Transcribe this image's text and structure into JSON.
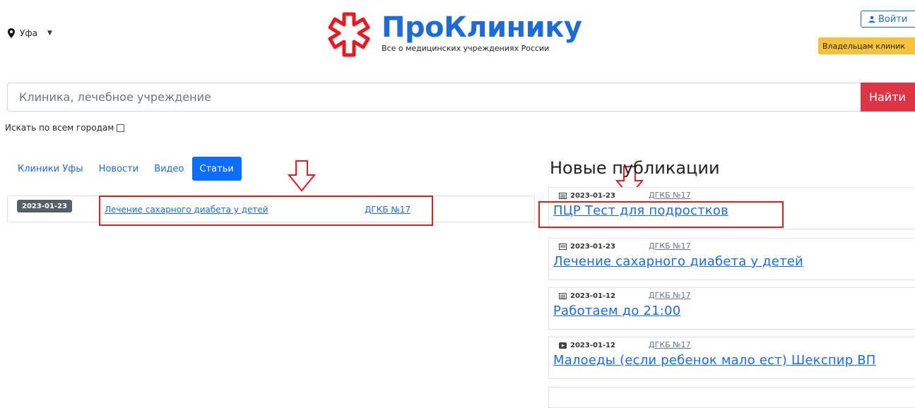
{
  "header": {
    "city": "Уфа",
    "logo_title": "ПроКлинику",
    "logo_subtitle": "Все о медицинских учреждениях России",
    "login_label": "Войти",
    "owners_label": "Владельцам клиник"
  },
  "search": {
    "placeholder": "Клиника, лечебное учреждение",
    "button_label": "Найти",
    "all_cities_label": "Искать по всем городам"
  },
  "tabs": [
    {
      "label": "Клиники Уфы",
      "active": false
    },
    {
      "label": "Новости",
      "active": false
    },
    {
      "label": "Видео",
      "active": false
    },
    {
      "label": "Статьи",
      "active": true
    }
  ],
  "articles": [
    {
      "date": "2023-01-23",
      "title": "Лечение сахарного диабета у детей",
      "org": "ДГКБ №17"
    }
  ],
  "publications": {
    "heading": "Новые публикации",
    "items": [
      {
        "icon": "news-icon",
        "date": "2023-01-23",
        "org": "ДГКБ №17",
        "title": "ПЦР Тест для подростков"
      },
      {
        "icon": "article-icon",
        "date": "2023-01-23",
        "org": "ДГКБ №17",
        "title": "Лечение сахарного диабета у детей"
      },
      {
        "icon": "news-icon",
        "date": "2023-01-12",
        "org": "ДГКБ №17",
        "title": "Работаем до 21:00"
      },
      {
        "icon": "video-icon",
        "date": "2023-01-12",
        "org": "ДГКБ №17",
        "title": "Малоеды (если ребенок мало ест) Шекспир ВП"
      }
    ]
  },
  "colors": {
    "brand_blue": "#1e6bd6",
    "search_red": "#dc3545",
    "owners_yellow": "#f6c23e",
    "highlight_red": "#e31b23"
  }
}
